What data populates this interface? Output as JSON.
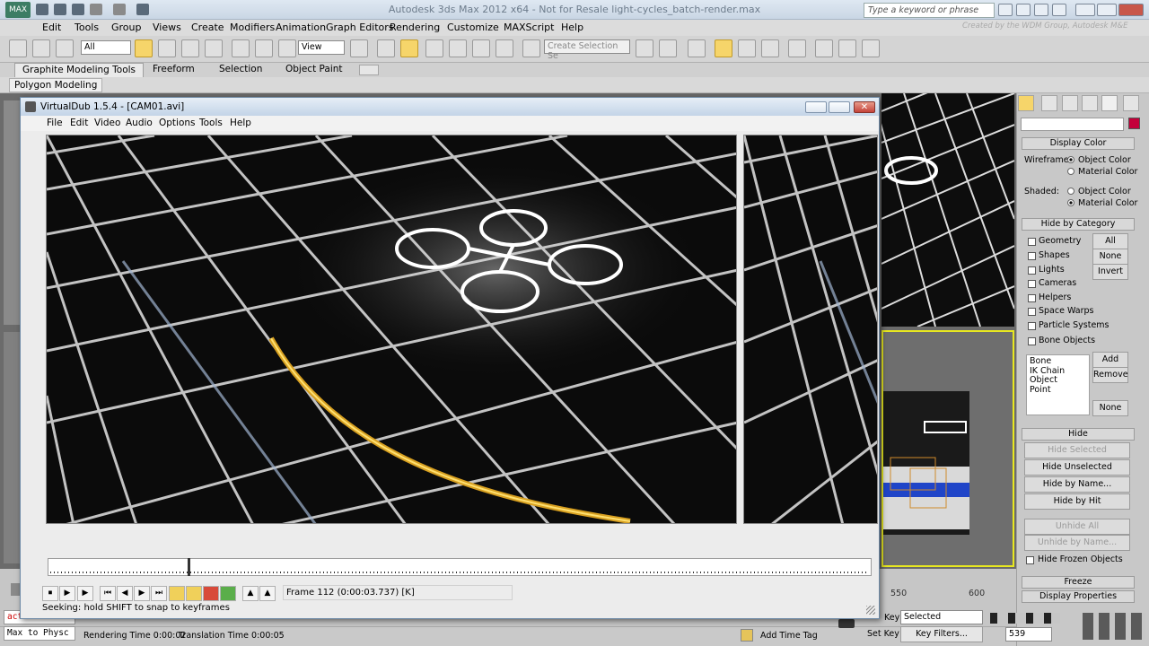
{
  "max": {
    "title": "Autodesk 3ds Max  2012 x64    -  Not for Resale     light-cycles_batch-render.max",
    "search_placeholder": "Type a keyword or phrase",
    "watermark": "Created by the WDM Group, Autodesk M&E",
    "menu": [
      "Edit",
      "Tools",
      "Group",
      "Views",
      "Create",
      "Modifiers",
      "Animation",
      "Graph Editors",
      "Rendering",
      "Customize",
      "MAXScript",
      "Help"
    ],
    "selection_filter": "All",
    "ref_coord": "View",
    "named_selection_placeholder": "Create Selection Se",
    "ribbon_tabs": [
      "Graphite Modeling Tools",
      "Freeform",
      "Selection",
      "Object Paint"
    ],
    "ribbon_panel": "Polygon Modeling"
  },
  "vdub": {
    "title": "VirtualDub 1.5.4 - [CAM01.avi]",
    "menu": [
      "File",
      "Edit",
      "Video",
      "Audio",
      "Options",
      "Tools",
      "Help"
    ],
    "frame_readout": "Frame 112 (0:00:03.737) [K]",
    "status": "Seeking: hold SHIFT to snap to keyframes",
    "playhead_fraction": 0.17
  },
  "command_panel": {
    "display_color": {
      "title": "Display Color",
      "wireframe_label": "Wireframe:",
      "shaded_label": "Shaded:",
      "object_color": "Object Color",
      "material_color": "Material Color"
    },
    "hide_by_category": {
      "title": "Hide by Category",
      "items": [
        "Geometry",
        "Shapes",
        "Lights",
        "Cameras",
        "Helpers",
        "Space Warps",
        "Particle Systems",
        "Bone Objects"
      ],
      "buttons": [
        "All",
        "None",
        "Invert"
      ],
      "list": [
        "Bone",
        "IK Chain Object",
        "Point"
      ],
      "add": "Add",
      "remove": "Remove",
      "none": "None"
    },
    "hide": {
      "title": "Hide",
      "buttons": [
        "Hide Selected",
        "Hide Unselected",
        "Hide by Name...",
        "Hide by Hit",
        "Unhide All",
        "Unhide by Name..."
      ],
      "hide_frozen": "Hide Frozen Objects"
    },
    "freeze_title": "Freeze",
    "display_props_title": "Display Properties"
  },
  "status_bar": {
    "maxscript_1": "actio",
    "maxscript_2": "Max to Physc",
    "rendering_time": "Rendering Time  0:00:02",
    "translation_time": "Translation Time  0:00:05",
    "add_time_tag": "Add Time Tag",
    "ruler_550": "550",
    "ruler_600": "600",
    "key_label": "Key",
    "set_key": "Set Key",
    "key_mode": "Selected",
    "key_filters": "Key Filters...",
    "frame_number": "539"
  }
}
